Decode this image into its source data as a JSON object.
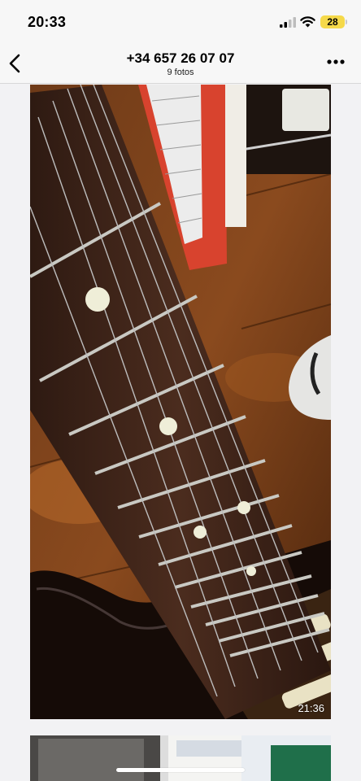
{
  "status": {
    "time": "20:33",
    "battery": "28"
  },
  "header": {
    "title": "+34 657 26 07 07",
    "subtitle": "9 fotos"
  },
  "photos": [
    {
      "timestamp": "21:36"
    }
  ],
  "colors": {
    "battery_fill": "#f5d94a",
    "background": "#f2f2f4"
  }
}
